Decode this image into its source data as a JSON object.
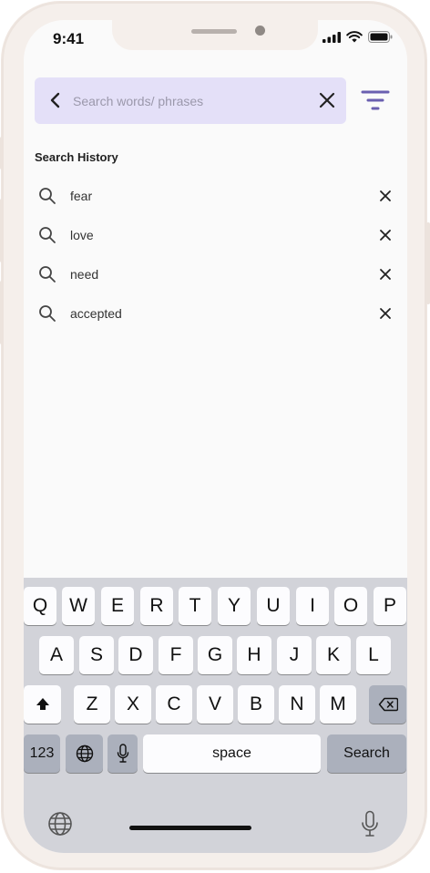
{
  "status_bar": {
    "time": "9:41"
  },
  "search": {
    "placeholder": "Search words/ phrases",
    "value": ""
  },
  "history": {
    "title": "Search History",
    "items": [
      {
        "label": "fear"
      },
      {
        "label": "love"
      },
      {
        "label": "need"
      },
      {
        "label": "accepted"
      }
    ]
  },
  "keyboard": {
    "row1": [
      "Q",
      "W",
      "E",
      "R",
      "T",
      "Y",
      "U",
      "I",
      "O",
      "P"
    ],
    "row2": [
      "A",
      "S",
      "D",
      "F",
      "G",
      "H",
      "J",
      "K",
      "L"
    ],
    "row3": [
      "Z",
      "X",
      "C",
      "V",
      "B",
      "N",
      "M"
    ],
    "numbers_key": "123",
    "space_key": "space",
    "action_key": "Search"
  },
  "colors": {
    "accent": "#6a5fb0",
    "search_bg": "#e4e0f8",
    "keyboard_bg": "#d2d3d9"
  }
}
